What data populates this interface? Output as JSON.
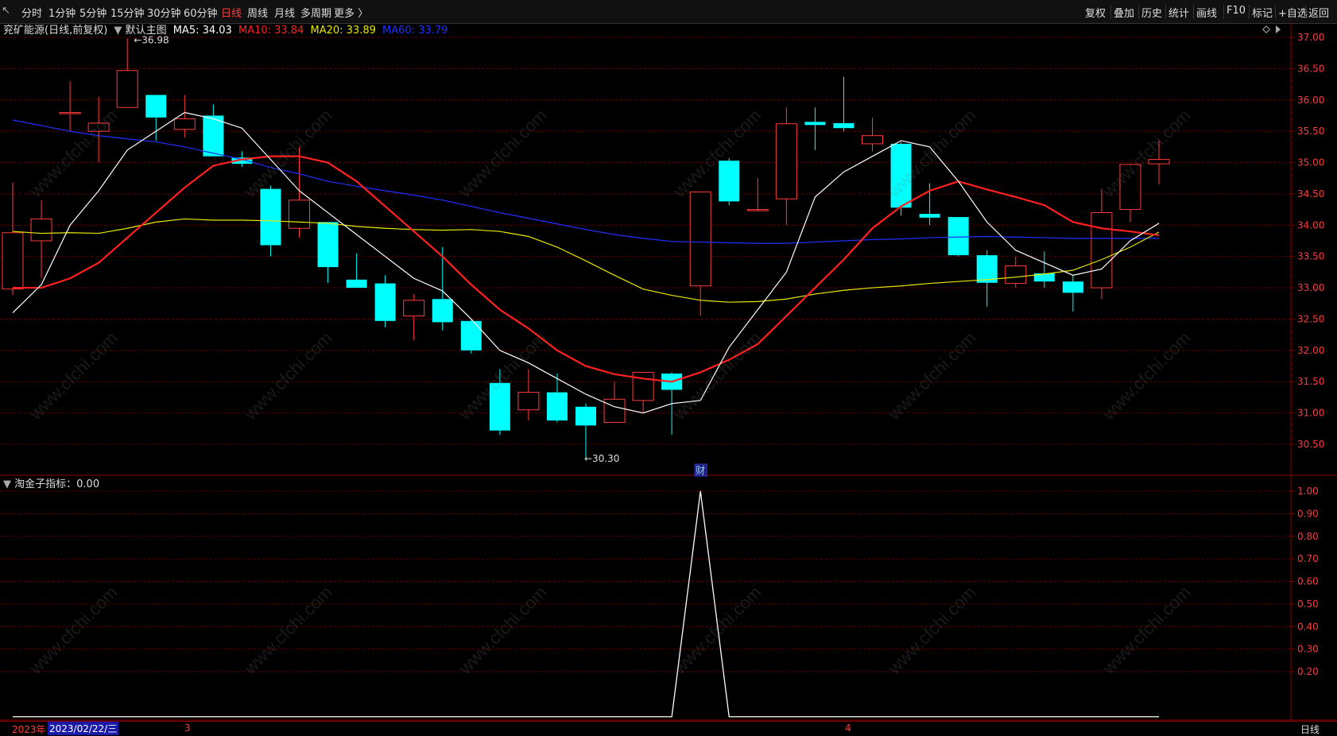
{
  "toolbar": {
    "corner": "↖",
    "periods": [
      "分时",
      "1分钟",
      "5分钟",
      "15分钟",
      "30分钟",
      "60分钟",
      "日线",
      "周线",
      "月线",
      "多周期",
      "更多 〉"
    ],
    "active_period": "日线",
    "right_buttons": [
      "复权",
      "叠加",
      "历史",
      "统计",
      "画线",
      "F10",
      "标记",
      "+自选",
      "返回"
    ]
  },
  "main_info": {
    "stock": "兖矿能源(日线,前复权)",
    "template": "默认主图",
    "ma5_label": "MA5: 34.03",
    "ma10_label": "MA10: 33.84",
    "ma20_label": "MA20: 33.89",
    "ma60_label": "MA60: 33.79",
    "colors": {
      "ma5": "#ffffff",
      "ma10": "#ff2020",
      "ma20": "#e8e800",
      "ma60": "#2030ff",
      "up": "#ff3b3b",
      "down": "#00ffff"
    }
  },
  "annotations": {
    "high": "36.98",
    "low": "30.30",
    "finance_marker": "财"
  },
  "sub_info": {
    "name": "淘金子指标：0.00"
  },
  "bottom": {
    "year_label": "2023年",
    "date_label": "2023/02/22/三",
    "month_3": "3",
    "month_4": "4",
    "period_label": "日线"
  },
  "watermark_text": "www.cfchi.com",
  "chart_data": [
    {
      "type": "candlestick",
      "title": "兖矿能源(日线,前复权)",
      "y_ticks": [
        "37.00",
        "36.50",
        "36.00",
        "35.50",
        "35.00",
        "34.50",
        "34.00",
        "33.50",
        "33.00",
        "32.50",
        "32.00",
        "31.50",
        "31.00",
        "30.50"
      ],
      "ylim": [
        30.15,
        37.08
      ],
      "candles": [
        {
          "o": 32.98,
          "h": 34.68,
          "l": 32.88,
          "c": 33.88
        },
        {
          "o": 33.75,
          "h": 34.4,
          "l": 33.15,
          "c": 34.1
        },
        {
          "o": 35.78,
          "h": 36.3,
          "l": 35.5,
          "c": 35.8
        },
        {
          "o": 35.5,
          "h": 36.05,
          "l": 35.0,
          "c": 35.63
        },
        {
          "o": 35.88,
          "h": 36.98,
          "l": 35.88,
          "c": 36.47
        },
        {
          "o": 36.08,
          "h": 36.06,
          "l": 35.35,
          "c": 35.72
        },
        {
          "o": 35.53,
          "h": 36.08,
          "l": 35.4,
          "c": 35.7
        },
        {
          "o": 35.75,
          "h": 35.93,
          "l": 35.1,
          "c": 35.1
        },
        {
          "o": 35.08,
          "h": 35.18,
          "l": 34.93,
          "c": 34.98
        },
        {
          "o": 34.58,
          "h": 34.63,
          "l": 33.5,
          "c": 33.68
        },
        {
          "o": 33.95,
          "h": 35.25,
          "l": 33.8,
          "c": 34.4
        },
        {
          "o": 34.05,
          "h": 34.05,
          "l": 33.08,
          "c": 33.33
        },
        {
          "o": 33.13,
          "h": 33.55,
          "l": 33.0,
          "c": 33.0
        },
        {
          "o": 33.07,
          "h": 33.2,
          "l": 32.37,
          "c": 32.47
        },
        {
          "o": 32.55,
          "h": 32.9,
          "l": 32.16,
          "c": 32.8
        },
        {
          "o": 32.82,
          "h": 33.65,
          "l": 32.32,
          "c": 32.45
        },
        {
          "o": 32.47,
          "h": 32.5,
          "l": 31.95,
          "c": 32.0
        },
        {
          "o": 31.48,
          "h": 31.7,
          "l": 30.65,
          "c": 30.72
        },
        {
          "o": 31.05,
          "h": 31.7,
          "l": 30.88,
          "c": 31.33
        },
        {
          "o": 31.33,
          "h": 31.63,
          "l": 30.85,
          "c": 30.88
        },
        {
          "o": 31.1,
          "h": 31.15,
          "l": 30.3,
          "c": 30.8
        },
        {
          "o": 30.85,
          "h": 31.5,
          "l": 30.85,
          "c": 31.22
        },
        {
          "o": 31.2,
          "h": 31.62,
          "l": 31.0,
          "c": 31.65
        },
        {
          "o": 31.63,
          "h": 31.65,
          "l": 30.65,
          "c": 31.37
        },
        {
          "o": 33.03,
          "h": 34.48,
          "l": 32.55,
          "c": 34.53
        },
        {
          "o": 35.03,
          "h": 35.07,
          "l": 34.32,
          "c": 34.38
        },
        {
          "o": 34.25,
          "h": 34.75,
          "l": 34.22,
          "c": 34.25
        },
        {
          "o": 34.42,
          "h": 35.88,
          "l": 34.0,
          "c": 35.62
        },
        {
          "o": 35.65,
          "h": 35.88,
          "l": 35.2,
          "c": 35.6
        },
        {
          "o": 35.63,
          "h": 36.37,
          "l": 35.5,
          "c": 35.55
        },
        {
          "o": 35.3,
          "h": 35.72,
          "l": 35.18,
          "c": 35.43
        },
        {
          "o": 35.3,
          "h": 35.33,
          "l": 34.15,
          "c": 34.28
        },
        {
          "o": 34.18,
          "h": 34.67,
          "l": 34.0,
          "c": 34.12
        },
        {
          "o": 34.13,
          "h": 34.13,
          "l": 33.5,
          "c": 33.52
        },
        {
          "o": 33.52,
          "h": 33.6,
          "l": 32.7,
          "c": 33.08
        },
        {
          "o": 33.07,
          "h": 33.5,
          "l": 33.0,
          "c": 33.35
        },
        {
          "o": 33.23,
          "h": 33.58,
          "l": 33.0,
          "c": 33.1
        },
        {
          "o": 33.1,
          "h": 33.2,
          "l": 32.62,
          "c": 32.92
        },
        {
          "o": 33.0,
          "h": 34.58,
          "l": 32.82,
          "c": 34.2
        },
        {
          "o": 34.25,
          "h": 34.98,
          "l": 34.05,
          "c": 34.97
        },
        {
          "o": 34.98,
          "h": 35.35,
          "l": 34.65,
          "c": 35.05
        }
      ],
      "ma5": [
        32.6,
        33.05,
        34.0,
        34.55,
        35.2,
        35.5,
        35.8,
        35.7,
        35.55,
        35.05,
        34.55,
        34.2,
        33.85,
        33.5,
        33.15,
        32.95,
        32.5,
        32.0,
        31.8,
        31.55,
        31.3,
        31.1,
        31.0,
        31.15,
        31.2,
        32.05,
        32.65,
        33.25,
        34.45,
        34.85,
        35.1,
        35.35,
        35.25,
        34.7,
        34.05,
        33.6,
        33.4,
        33.2,
        33.3,
        33.75,
        34.03
      ],
      "ma10": [
        33.0,
        33.0,
        33.15,
        33.4,
        33.8,
        34.2,
        34.6,
        34.95,
        35.05,
        35.1,
        35.1,
        35.0,
        34.7,
        34.3,
        33.9,
        33.5,
        33.05,
        32.65,
        32.35,
        32.0,
        31.75,
        31.62,
        31.55,
        31.5,
        31.65,
        31.85,
        32.1,
        32.55,
        33.0,
        33.45,
        33.95,
        34.3,
        34.55,
        34.7,
        34.57,
        34.45,
        34.32,
        34.05,
        33.95,
        33.9,
        33.84
      ],
      "ma20": [
        33.9,
        33.87,
        33.88,
        33.87,
        33.95,
        34.05,
        34.1,
        34.08,
        34.08,
        34.07,
        34.05,
        34.03,
        33.98,
        33.95,
        33.93,
        33.92,
        33.93,
        33.9,
        33.82,
        33.65,
        33.43,
        33.2,
        32.98,
        32.88,
        32.8,
        32.77,
        32.78,
        32.82,
        32.9,
        32.96,
        33.0,
        33.03,
        33.07,
        33.1,
        33.13,
        33.17,
        33.22,
        33.28,
        33.45,
        33.65,
        33.89
      ],
      "ma60": [
        35.68,
        35.59,
        35.5,
        35.43,
        35.38,
        35.33,
        35.25,
        35.15,
        35.05,
        34.92,
        34.82,
        34.7,
        34.62,
        34.55,
        34.48,
        34.4,
        34.3,
        34.2,
        34.11,
        34.02,
        33.93,
        33.85,
        33.79,
        33.74,
        33.73,
        33.72,
        33.71,
        33.71,
        33.73,
        33.75,
        33.77,
        33.78,
        33.8,
        33.81,
        33.82,
        33.81,
        33.8,
        33.79,
        33.79,
        33.79,
        33.79
      ]
    },
    {
      "type": "line",
      "title": "淘金子指标",
      "y_ticks": [
        "1.00",
        "0.90",
        "0.80",
        "0.70",
        "0.60",
        "0.50",
        "0.40",
        "0.30",
        "0.20"
      ],
      "ylim": [
        0.0,
        1.0
      ],
      "values": [
        0,
        0,
        0,
        0,
        0,
        0,
        0,
        0,
        0,
        0,
        0,
        0,
        0,
        0,
        0,
        0,
        0,
        0,
        0,
        0,
        0,
        0,
        0,
        0,
        1,
        0,
        0,
        0,
        0,
        0,
        0,
        0,
        0,
        0,
        0,
        0,
        0,
        0,
        0,
        0,
        0
      ]
    }
  ]
}
